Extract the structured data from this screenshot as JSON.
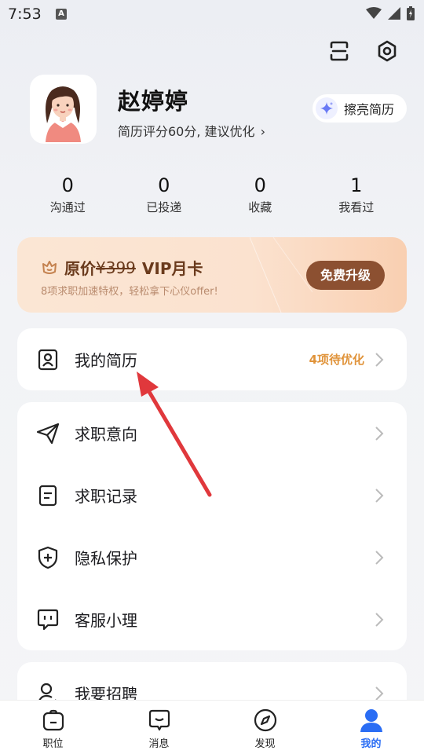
{
  "status_bar": {
    "time": "7:53",
    "badge": "A"
  },
  "profile": {
    "name": "赵婷婷",
    "subtitle": "简历评分60分, 建议优化",
    "polish_button": "擦亮简历"
  },
  "stats": [
    {
      "value": "0",
      "label": "沟通过"
    },
    {
      "value": "0",
      "label": "已投递"
    },
    {
      "value": "0",
      "label": "收藏"
    },
    {
      "value": "1",
      "label": "我看过"
    }
  ],
  "vip": {
    "title_prefix": "原价",
    "price": "¥399",
    "title_suffix": "VIP月卡",
    "desc": "8项求职加速特权，轻松拿下心仪offer!",
    "button": "免费升级"
  },
  "resume_row": {
    "label": "我的简历",
    "hint": "4项待优化"
  },
  "menu": [
    {
      "label": "求职意向",
      "icon": "send-icon"
    },
    {
      "label": "求职记录",
      "icon": "document-icon"
    },
    {
      "label": "隐私保护",
      "icon": "shield-icon"
    },
    {
      "label": "客服小理",
      "icon": "chat-icon"
    }
  ],
  "recruit_row": {
    "label": "我要招聘"
  },
  "tabs": [
    {
      "label": "职位",
      "icon": "briefcase-icon"
    },
    {
      "label": "消息",
      "icon": "message-icon"
    },
    {
      "label": "发现",
      "icon": "compass-icon"
    },
    {
      "label": "我的",
      "icon": "user-icon",
      "active": true
    }
  ],
  "colors": {
    "accent": "#2a6df4",
    "vip_button": "#8c5031",
    "hint": "#e0933a",
    "annotation_arrow": "#e0383c"
  }
}
